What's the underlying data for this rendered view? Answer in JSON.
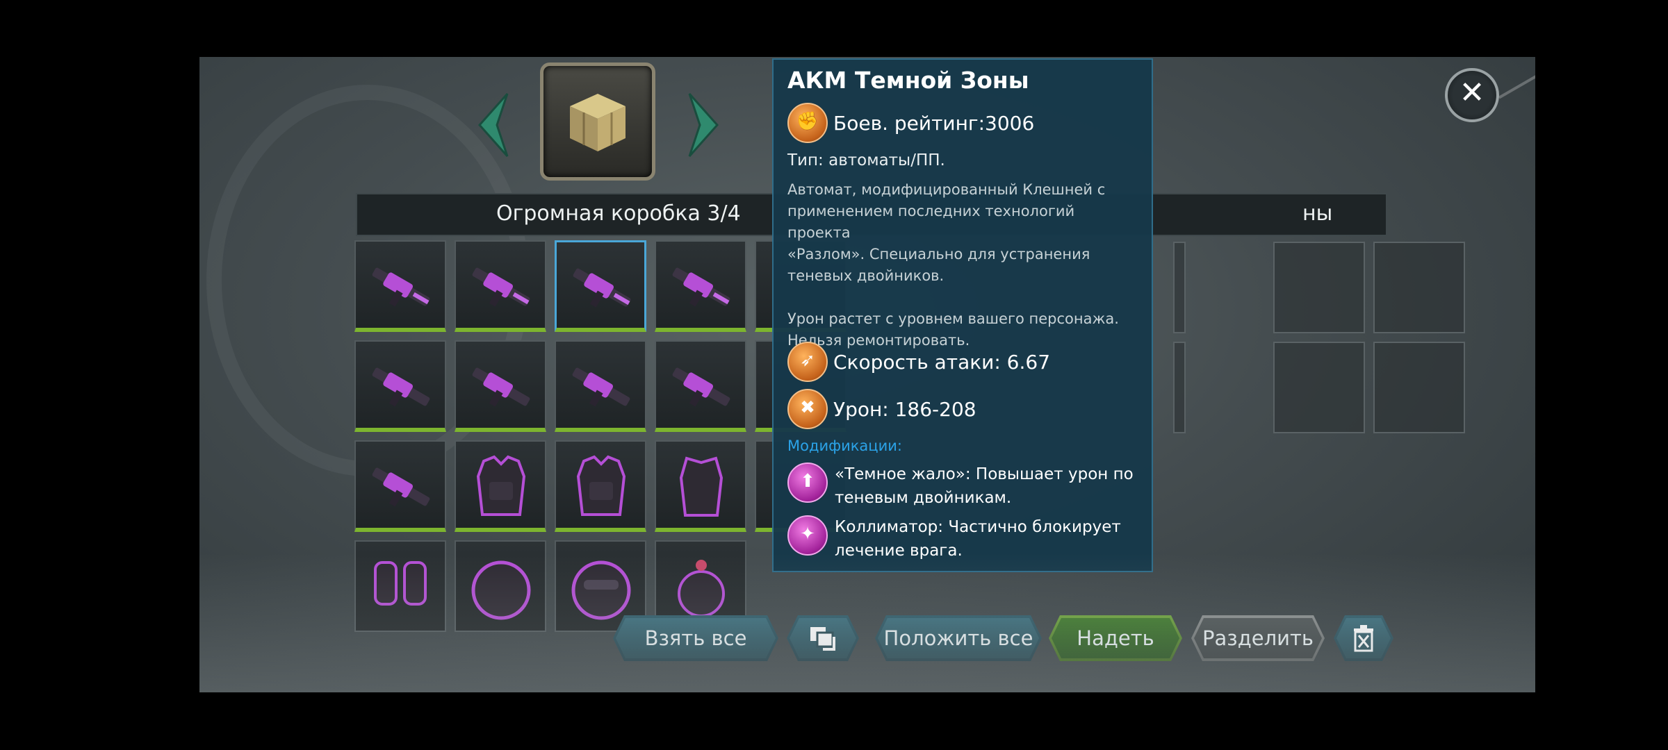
{
  "header": {
    "box_title": "Огромная коробка  3/4",
    "box_title_right_fragment": "ны"
  },
  "tooltip": {
    "title": "АКМ Темной Зоны",
    "rating": "Боев. рейтинг:3006",
    "type": "Тип: автоматы/ПП.",
    "description": "Автомат, модифицированный Клешней с\nприменением последних технологий проекта\n«Разлом». Специально для устранения\nтеневых двойников.\n\nУрон растет с уровнем вашего персонажа.\nНельзя ремонтировать.",
    "attack_speed": "Скорость атаки: 6.67",
    "damage": "Урон: 186-208",
    "mods_title": "Модификации:",
    "mod1": "«Темное жало»: Повышает урон по\nтеневым двойникам.",
    "mod2": "Коллиматор: Частично блокирует\nлечение врага."
  },
  "buttons": {
    "take_all": "Взять все",
    "put_all": "Положить все",
    "equip": "Надеть",
    "split": "Разделить"
  },
  "icons": {
    "close": "close-icon",
    "stack": "stack-icon",
    "delete": "delete-icon"
  },
  "colors": {
    "tooltip_bg": "#16384a",
    "mods_title": "#2ba3e8",
    "rarity_green": "#7db52f",
    "selected_border": "#4aa7d8",
    "equip_button": "#3e7a2a"
  }
}
